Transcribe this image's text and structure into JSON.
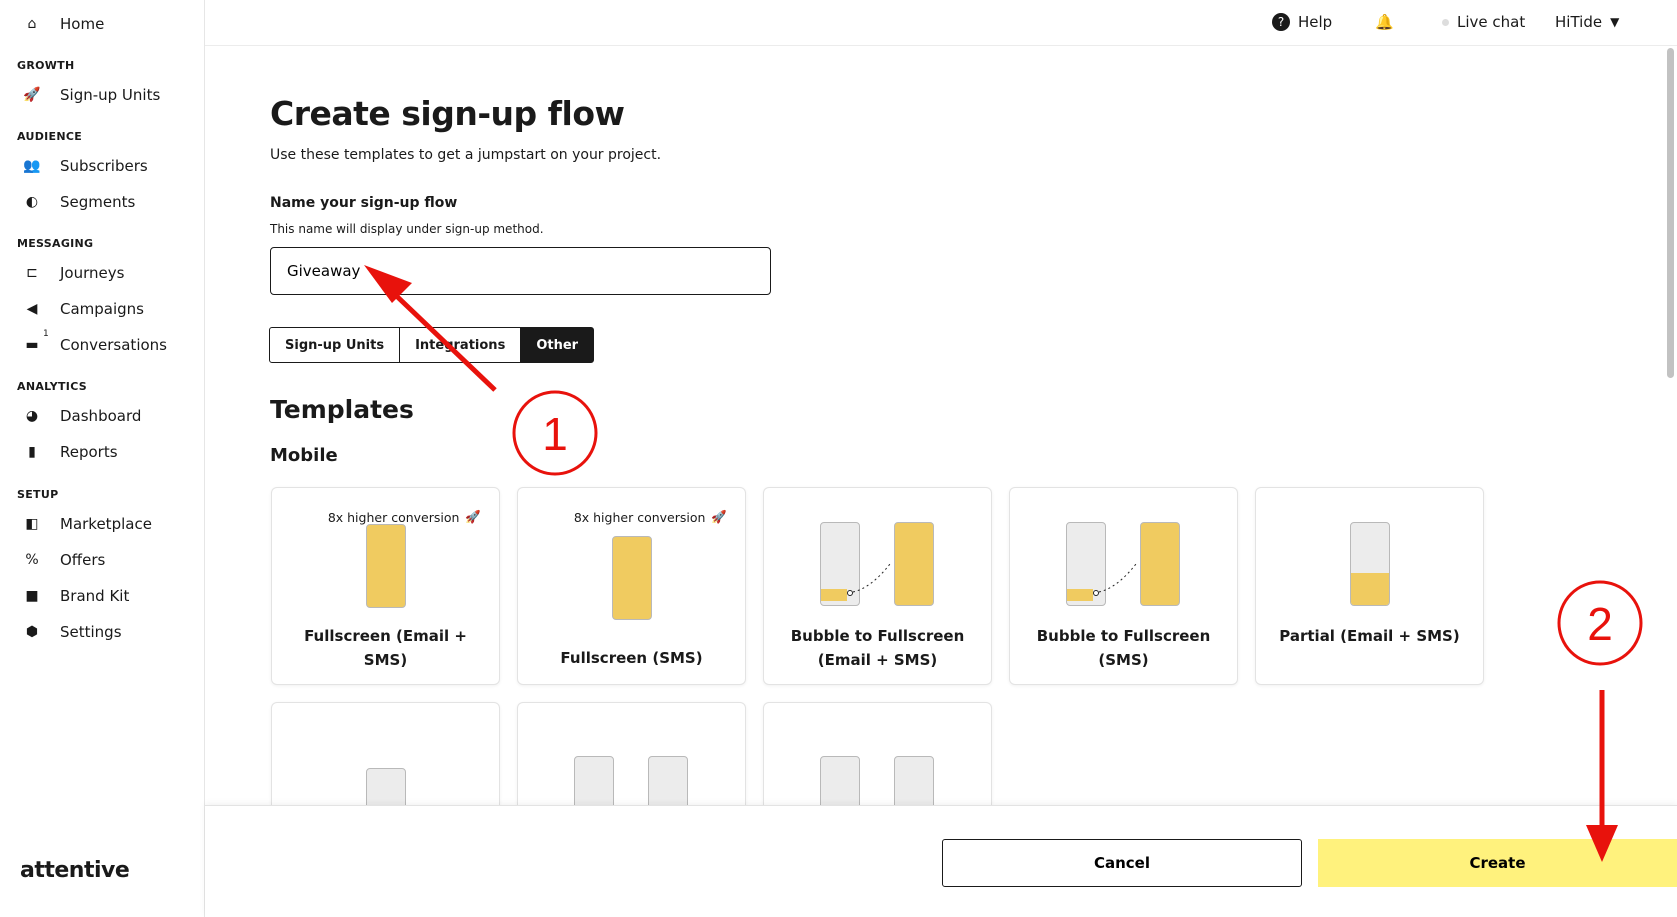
{
  "sidebar": {
    "home": "Home",
    "sections": {
      "growth": "GROWTH",
      "audience": "AUDIENCE",
      "messaging": "MESSAGING",
      "analytics": "ANALYTICS",
      "setup": "SETUP"
    },
    "items": {
      "signup_units": "Sign-up Units",
      "subscribers": "Subscribers",
      "segments": "Segments",
      "journeys": "Journeys",
      "campaigns": "Campaigns",
      "conversations": "Conversations",
      "conversations_badge": "1",
      "dashboard": "Dashboard",
      "reports": "Reports",
      "marketplace": "Marketplace",
      "offers": "Offers",
      "brand_kit": "Brand Kit",
      "settings": "Settings"
    },
    "logo": "attentive"
  },
  "topbar": {
    "help": "Help",
    "live_chat": "Live chat",
    "account": "HiTide"
  },
  "page": {
    "title": "Create sign-up flow",
    "subtitle": "Use these templates to get a jumpstart on your project.",
    "name_label": "Name your sign-up flow",
    "name_hint": "This name will display under sign-up method.",
    "name_value": "Giveaway",
    "tabs": [
      {
        "label": "Sign-up Units"
      },
      {
        "label": "Integrations"
      },
      {
        "label": "Other",
        "active": true
      }
    ],
    "templates_heading": "Templates",
    "mobile_heading": "Mobile",
    "cards": [
      {
        "promo": "8x higher conversion",
        "name": "Fullscreen (Email + SMS)"
      },
      {
        "promo": "8x higher conversion",
        "name": "Fullscreen (SMS)"
      },
      {
        "name": "Bubble to Fullscreen (Email + SMS)"
      },
      {
        "name": "Bubble to Fullscreen (SMS)"
      },
      {
        "name": "Partial (Email + SMS)"
      }
    ]
  },
  "footer": {
    "cancel": "Cancel",
    "create": "Create"
  },
  "annotations": {
    "step1": "1",
    "step2": "2",
    "color": "#e8120c"
  },
  "colors": {
    "accent": "#fff27d",
    "phone_fill": "#f0cb60"
  }
}
